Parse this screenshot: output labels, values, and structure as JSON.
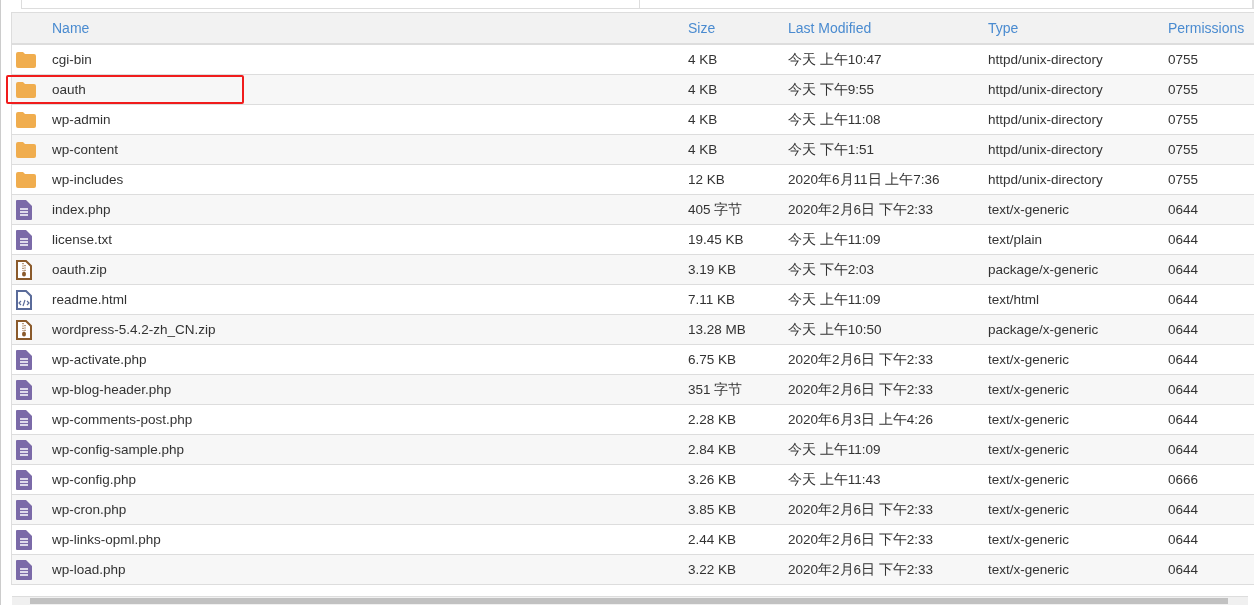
{
  "table": {
    "columns": [
      "Name",
      "Size",
      "Last Modified",
      "Type",
      "Permissions"
    ],
    "rows": [
      {
        "kind": "folder",
        "name": "cgi-bin",
        "size": "4 KB",
        "modified": "今天 上午10:47",
        "type": "httpd/unix-directory",
        "permissions": "0755",
        "highlighted": false
      },
      {
        "kind": "folder",
        "name": "oauth",
        "size": "4 KB",
        "modified": "今天 下午9:55",
        "type": "httpd/unix-directory",
        "permissions": "0755",
        "highlighted": true
      },
      {
        "kind": "folder",
        "name": "wp-admin",
        "size": "4 KB",
        "modified": "今天 上午11:08",
        "type": "httpd/unix-directory",
        "permissions": "0755",
        "highlighted": false
      },
      {
        "kind": "folder",
        "name": "wp-content",
        "size": "4 KB",
        "modified": "今天 下午1:51",
        "type": "httpd/unix-directory",
        "permissions": "0755",
        "highlighted": false
      },
      {
        "kind": "folder",
        "name": "wp-includes",
        "size": "12 KB",
        "modified": "2020年6月11日 上午7:36",
        "type": "httpd/unix-directory",
        "permissions": "0755",
        "highlighted": false
      },
      {
        "kind": "text",
        "name": "index.php",
        "size": "405 字节",
        "modified": "2020年2月6日 下午2:33",
        "type": "text/x-generic",
        "permissions": "0644",
        "highlighted": false
      },
      {
        "kind": "text",
        "name": "license.txt",
        "size": "19.45 KB",
        "modified": "今天 上午11:09",
        "type": "text/plain",
        "permissions": "0644",
        "highlighted": false
      },
      {
        "kind": "zip",
        "name": "oauth.zip",
        "size": "3.19 KB",
        "modified": "今天 下午2:03",
        "type": "package/x-generic",
        "permissions": "0644",
        "highlighted": false
      },
      {
        "kind": "html",
        "name": "readme.html",
        "size": "7.11 KB",
        "modified": "今天 上午11:09",
        "type": "text/html",
        "permissions": "0644",
        "highlighted": false
      },
      {
        "kind": "zip",
        "name": "wordpress-5.4.2-zh_CN.zip",
        "size": "13.28 MB",
        "modified": "今天 上午10:50",
        "type": "package/x-generic",
        "permissions": "0644",
        "highlighted": false
      },
      {
        "kind": "text",
        "name": "wp-activate.php",
        "size": "6.75 KB",
        "modified": "2020年2月6日 下午2:33",
        "type": "text/x-generic",
        "permissions": "0644",
        "highlighted": false
      },
      {
        "kind": "text",
        "name": "wp-blog-header.php",
        "size": "351 字节",
        "modified": "2020年2月6日 下午2:33",
        "type": "text/x-generic",
        "permissions": "0644",
        "highlighted": false
      },
      {
        "kind": "text",
        "name": "wp-comments-post.php",
        "size": "2.28 KB",
        "modified": "2020年6月3日 上午4:26",
        "type": "text/x-generic",
        "permissions": "0644",
        "highlighted": false
      },
      {
        "kind": "text",
        "name": "wp-config-sample.php",
        "size": "2.84 KB",
        "modified": "今天 上午11:09",
        "type": "text/x-generic",
        "permissions": "0644",
        "highlighted": false
      },
      {
        "kind": "text",
        "name": "wp-config.php",
        "size": "3.26 KB",
        "modified": "今天 上午11:43",
        "type": "text/x-generic",
        "permissions": "0666",
        "highlighted": false
      },
      {
        "kind": "text",
        "name": "wp-cron.php",
        "size": "3.85 KB",
        "modified": "2020年2月6日 下午2:33",
        "type": "text/x-generic",
        "permissions": "0644",
        "highlighted": false
      },
      {
        "kind": "text",
        "name": "wp-links-opml.php",
        "size": "2.44 KB",
        "modified": "2020年2月6日 下午2:33",
        "type": "text/x-generic",
        "permissions": "0644",
        "highlighted": false
      },
      {
        "kind": "text",
        "name": "wp-load.php",
        "size": "3.22 KB",
        "modified": "2020年2月6日 下午2:33",
        "type": "text/x-generic",
        "permissions": "0644",
        "highlighted": false
      }
    ]
  }
}
